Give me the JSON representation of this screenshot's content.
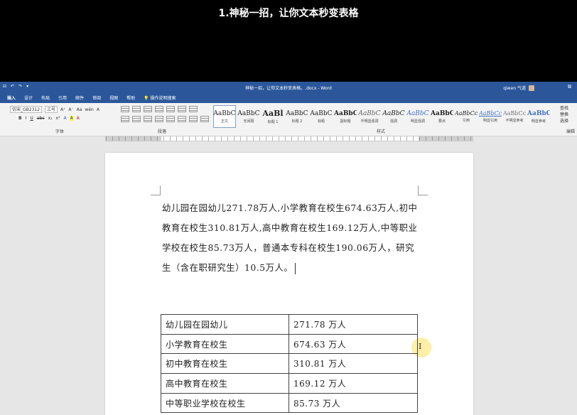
{
  "video_title": "1.神秘一招，让你文本秒变表格",
  "window": {
    "title": "神秘一招，让你文本秒变表格。.docx - Word",
    "user": "qiwen 气道",
    "qat": [
      "⊟",
      "↶",
      "↷",
      "▾"
    ]
  },
  "tabs": [
    "插入",
    "设计",
    "布局",
    "引用",
    "邮件",
    "审阅",
    "视图",
    "帮助"
  ],
  "tell_me": "操作说明搜索",
  "ribbon": {
    "font_name": "仿宋_GB2312",
    "font_size": "三号",
    "font_group_label": "字体",
    "para_group_label": "段落",
    "styles_group_label": "样式",
    "edit_group_label": "编辑",
    "font_buttons": [
      "B",
      "I",
      "U",
      "abc",
      "x₂",
      "x²",
      "A",
      "A",
      "A"
    ],
    "grow_shrink": [
      "A⁺",
      "A⁻",
      "Aa",
      "wén",
      "A"
    ],
    "edit_items": [
      "查找",
      "替换",
      "选择"
    ],
    "styles": [
      {
        "preview": "AaBbC",
        "name": "正文"
      },
      {
        "preview": "AaBbC",
        "name": "无间隔"
      },
      {
        "preview": "AaBl",
        "name": "标题 1"
      },
      {
        "preview": "AaBbC",
        "name": "标题 2"
      },
      {
        "preview": "AaBbC",
        "name": "标题"
      },
      {
        "preview": "AaBbC",
        "name": "副标题"
      },
      {
        "preview": "AaBbC",
        "name": "不明显强调"
      },
      {
        "preview": "AaBbC",
        "name": "强调"
      },
      {
        "preview": "AaBbC",
        "name": "明显强调"
      },
      {
        "preview": "AaBbC",
        "name": "要点"
      },
      {
        "preview": "AaBbCc",
        "name": "引用"
      },
      {
        "preview": "AaBbCc",
        "name": "明显引用"
      },
      {
        "preview": "AaBbCc",
        "name": "不明显参考"
      },
      {
        "preview": "AaBbC",
        "name": "明显参考"
      }
    ]
  },
  "document": {
    "paragraph": "幼儿园在园幼儿271.78万人,小学教育在校生674.63万人,初中教育在校生310.81万人,高中教育在校生169.12万人,中等职业学校在校生85.73万人，普通本专科在校生190.06万人，研究生（含在职研究生）10.5万人。",
    "table": [
      [
        "幼儿园在园幼儿",
        "271.78 万人"
      ],
      [
        "小学教育在校生",
        "674.63 万人"
      ],
      [
        "初中教育在校生",
        "310.81 万人"
      ],
      [
        "高中教育在校生",
        "169.12 万人"
      ],
      [
        "中等职业学校在校生",
        "85.73 万人"
      ]
    ]
  },
  "cursor_label": "I",
  "colors": {
    "title_bar": "#2b579a",
    "ribbon": "#f3f3f3",
    "canvas": "#e6e6e6"
  }
}
